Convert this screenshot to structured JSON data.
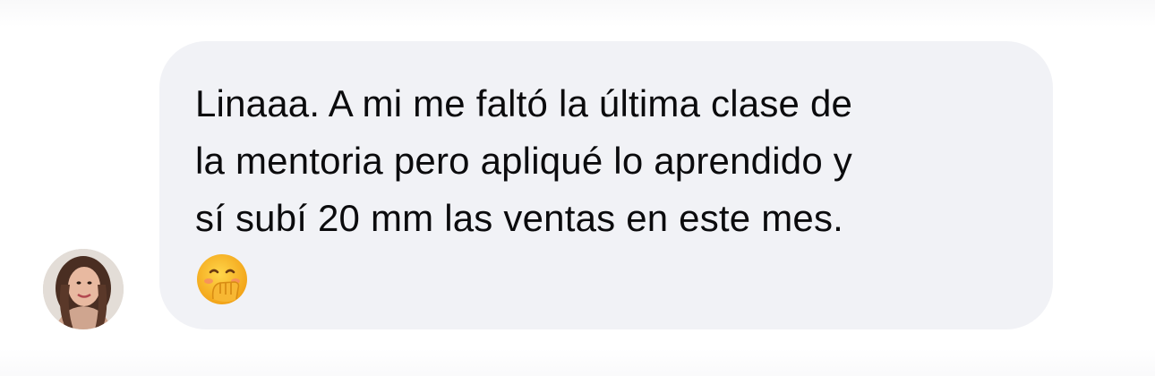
{
  "conversation": {
    "message": {
      "text": "Linaaa. A mi me faltó la última clase de\nla mentoria pero apliqué lo aprendido y\nsí subí 20 mm las ventas en este mes.",
      "emoji": "face-with-hand-over-mouth-emoji"
    },
    "sender": {
      "avatar": "avatar-photo"
    }
  },
  "colors": {
    "bubble_background": "#f1f2f6",
    "text": "#0b0b0d",
    "page_background": "#ffffff"
  }
}
